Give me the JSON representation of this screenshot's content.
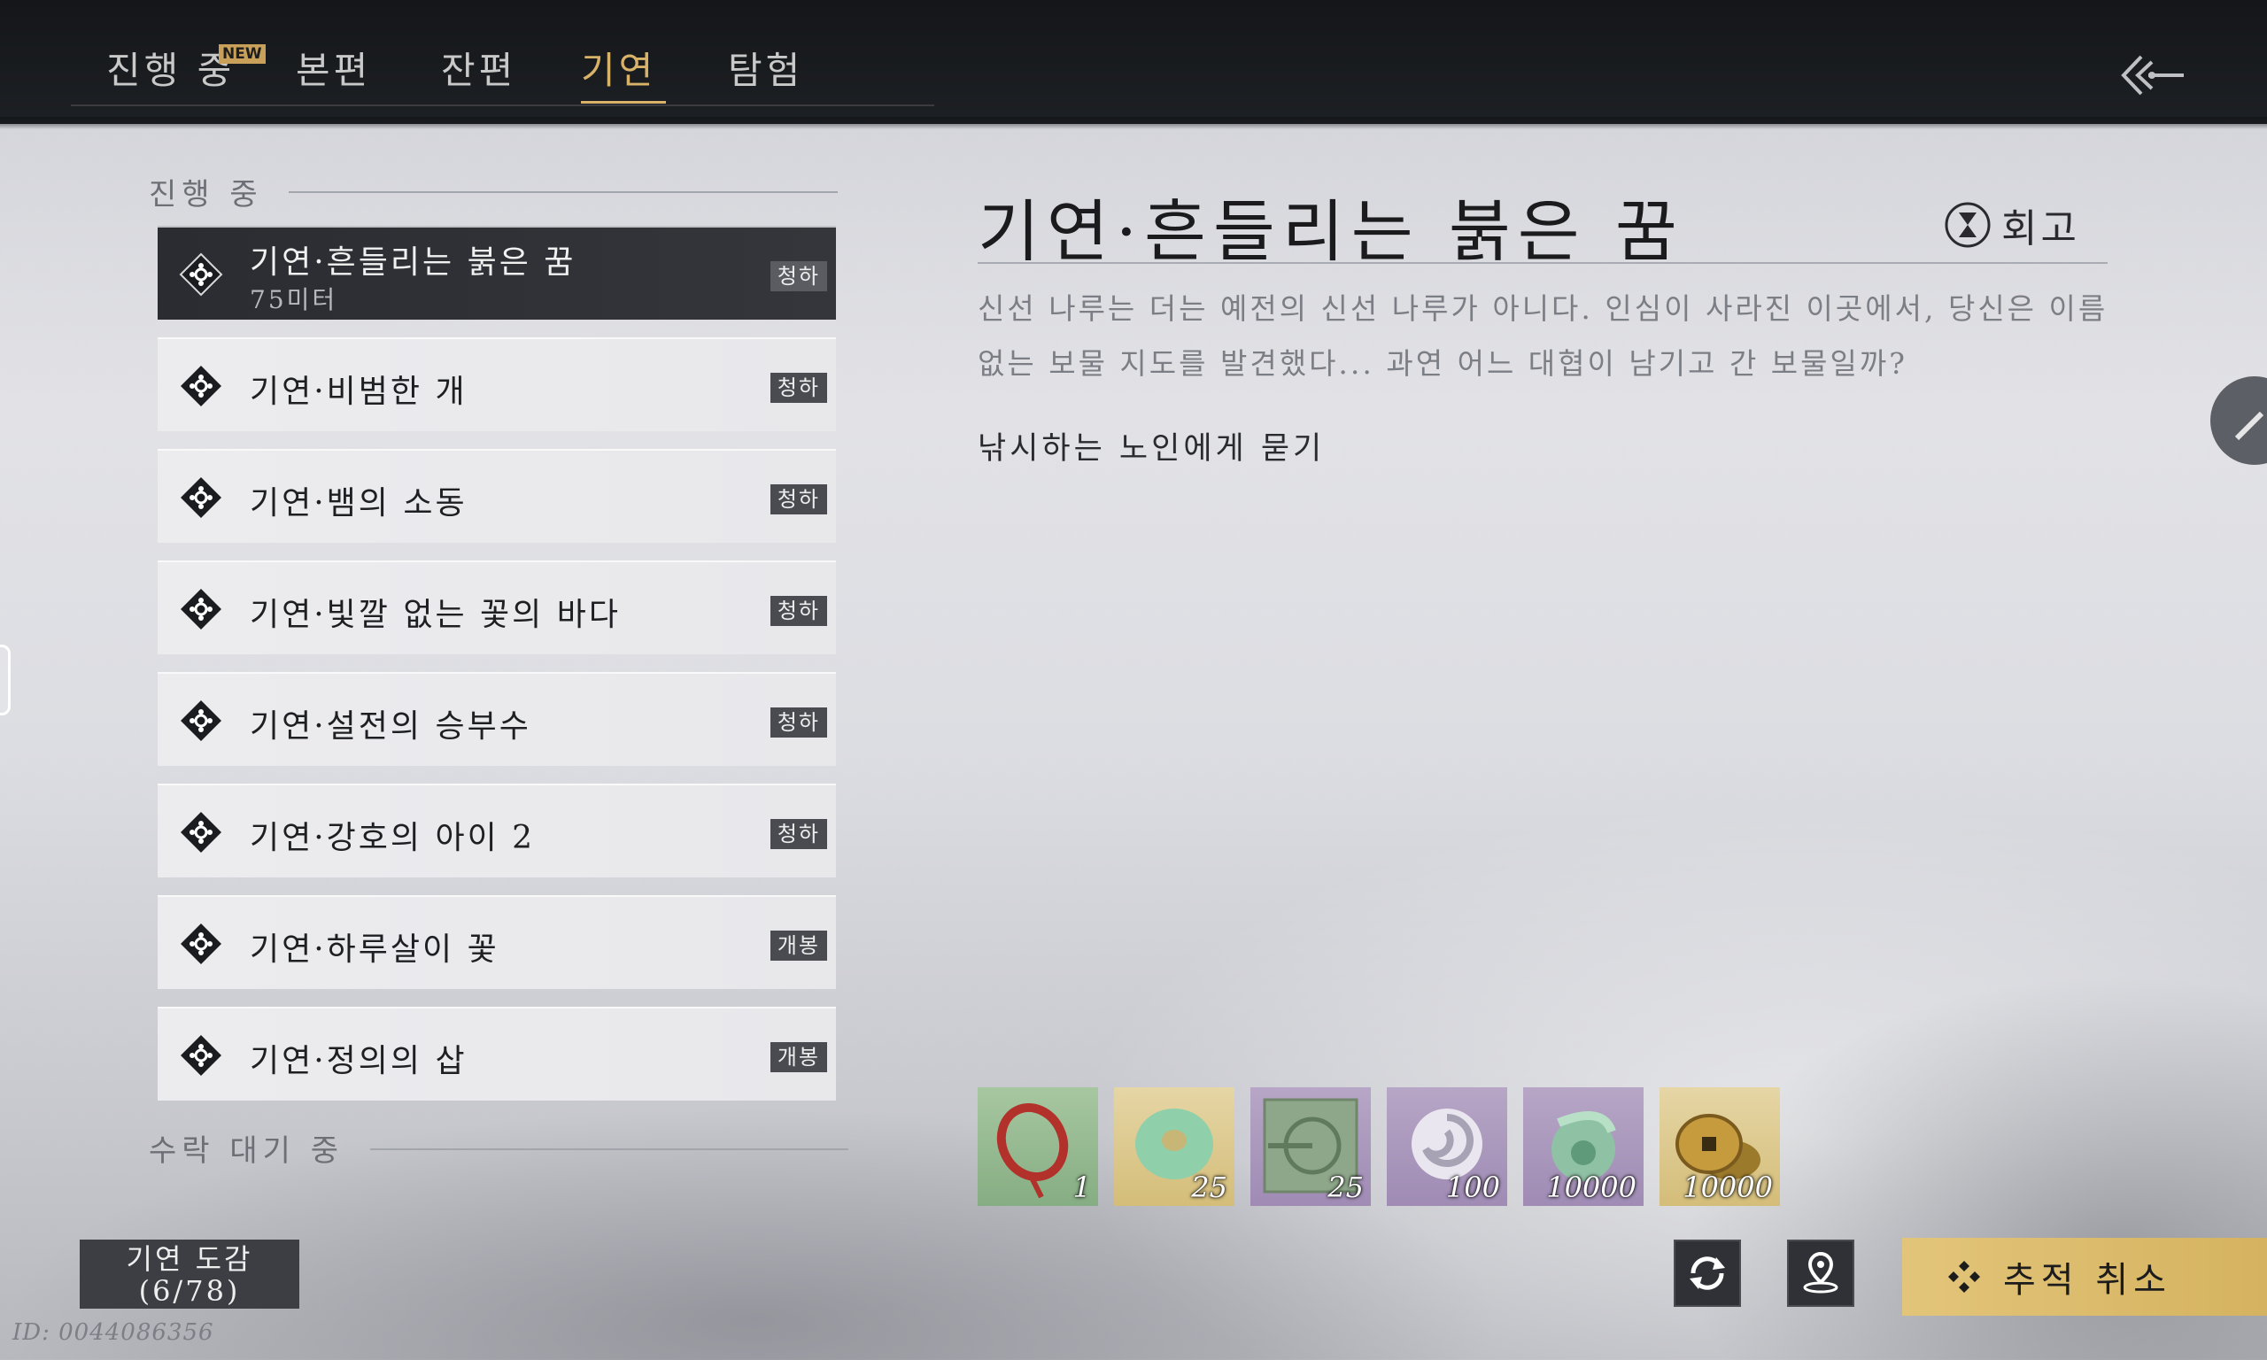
{
  "tabs": [
    {
      "label": "진행 중",
      "badge": "NEW"
    },
    {
      "label": "본편"
    },
    {
      "label": "잔편"
    },
    {
      "label": "기연",
      "active": true
    },
    {
      "label": "탐험"
    }
  ],
  "list": {
    "in_progress_label": "진행 중",
    "pending_label": "수락 대기 중",
    "items": [
      {
        "title": "기연·흔들리는 붉은 꿈",
        "subtitle": "75미터",
        "badge": "청하",
        "selected": true
      },
      {
        "title": "기연·비범한 개",
        "badge": "청하"
      },
      {
        "title": "기연·뱀의 소동",
        "badge": "청하"
      },
      {
        "title": "기연·빛깔 없는 꽃의 바다",
        "badge": "청하"
      },
      {
        "title": "기연·설전의 승부수",
        "badge": "청하"
      },
      {
        "title": "기연·강호의 아이 2",
        "badge": "청하"
      },
      {
        "title": "기연·하루살이 꽃",
        "badge": "개봉"
      },
      {
        "title": "기연·정의의 삽",
        "badge": "개봉"
      }
    ]
  },
  "detail": {
    "title": "기연·흔들리는 붉은 꿈",
    "recall_label": "회고",
    "description": "신선 나루는 더는 예전의 신선 나루가 아니다. 인심이 사라진 이곳에서, 당신은 이름 없는 보물 지도를 발견했다... 과연 어느 대협이 남기고 간 보물일까?",
    "objective": "낚시하는 노인에게 묻기"
  },
  "rewards": [
    {
      "icon": "red-bracelet-icon",
      "count": "1",
      "rarity": "green"
    },
    {
      "icon": "jade-disc-icon",
      "count": "25",
      "rarity": "gold"
    },
    {
      "icon": "scroll-seal-icon",
      "count": "25",
      "rarity": "purple"
    },
    {
      "icon": "swirl-orb-icon",
      "count": "100",
      "rarity": "purple"
    },
    {
      "icon": "jade-swirl-icon",
      "count": "10000",
      "rarity": "purple"
    },
    {
      "icon": "coin-stack-icon",
      "count": "10000",
      "rarity": "gold"
    }
  ],
  "bottom": {
    "catalog_line1": "기연 도감",
    "catalog_line2": "(6/78)",
    "player_id": "ID: 0044086356",
    "track_label": "추적 취소"
  },
  "colors": {
    "accent": "#d9b26a",
    "topbar": "#1a1c20",
    "track_button": "#dcbc6b"
  }
}
